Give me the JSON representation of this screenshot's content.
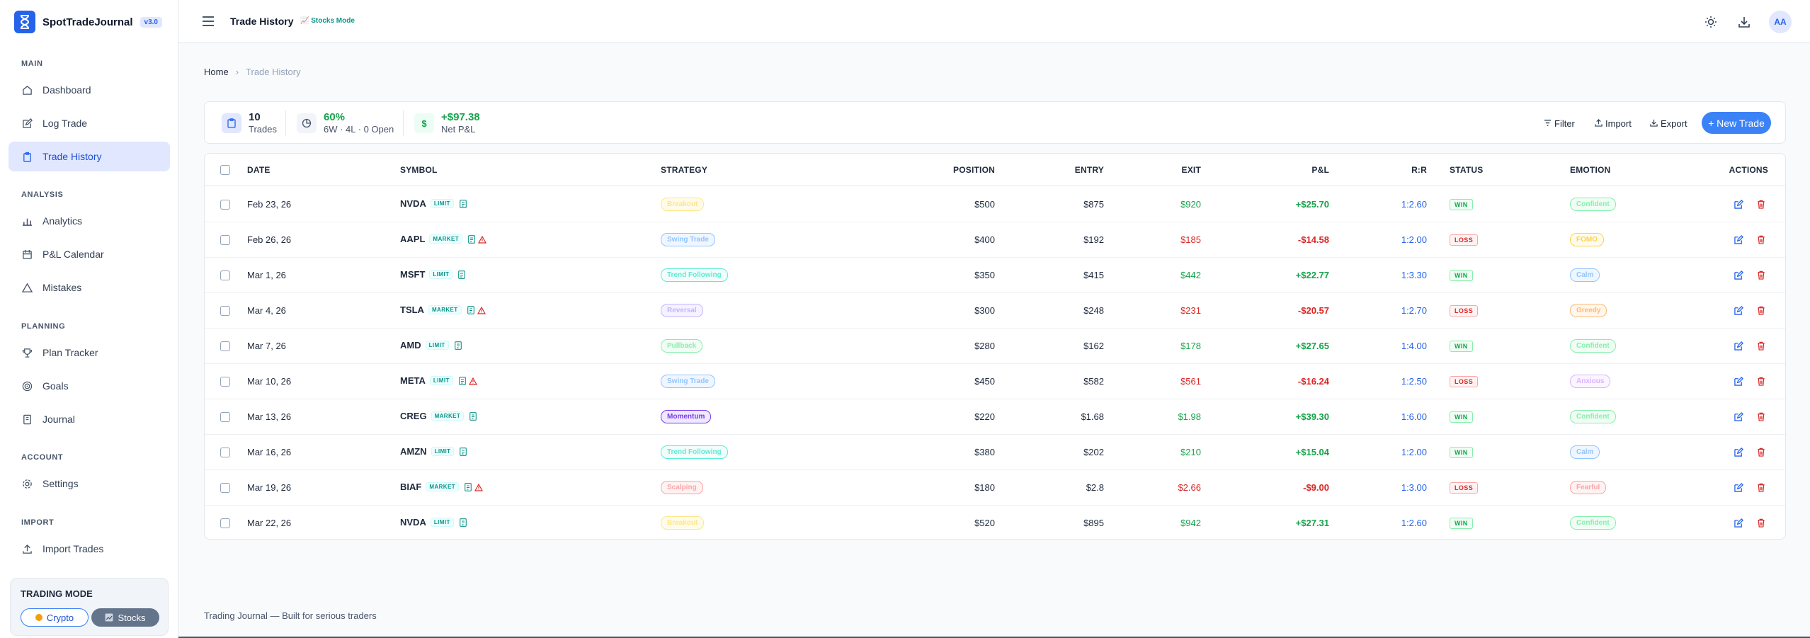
{
  "brand": {
    "name": "SpotTradeJournal",
    "version": "v3.0"
  },
  "nav": {
    "main": "MAIN",
    "dashboard": "Dashboard",
    "log_trade": "Log Trade",
    "trade_history": "Trade History",
    "analysis": "ANALYSIS",
    "analytics": "Analytics",
    "pnl_calendar": "P&L Calendar",
    "mistakes": "Mistakes",
    "planning": "PLANNING",
    "plan_tracker": "Plan Tracker",
    "goals": "Goals",
    "journal": "Journal",
    "account": "ACCOUNT",
    "settings": "Settings",
    "import": "IMPORT",
    "import_trades": "Import Trades"
  },
  "trading_mode": {
    "title": "TRADING MODE",
    "crypto": "Crypto",
    "stocks": "Stocks",
    "active": "Stocks"
  },
  "header": {
    "title": "Trade History",
    "mode_chip": "📈 Stocks Mode",
    "avatar": "AA"
  },
  "breadcrumb": {
    "home": "Home",
    "current": "Trade History"
  },
  "stats": {
    "trades_value": "10",
    "trades_label": "Trades",
    "winrate_value": "60%",
    "winrate_label": "6W · 4L · 0 Open",
    "pnl_value": "+$97.38",
    "pnl_label": "Net P&L"
  },
  "actions": {
    "filter": "Filter",
    "import": "Import",
    "export": "Export",
    "new_trade": "+ New Trade"
  },
  "table": {
    "headers": {
      "date": "DATE",
      "symbol": "SYMBOL",
      "strategy": "STRATEGY",
      "position": "POSITION",
      "entry": "ENTRY",
      "exit": "EXIT",
      "pnl": "P&L",
      "rr": "R:R",
      "status": "STATUS",
      "emotion": "EMOTION",
      "actions": "ACTIONS"
    },
    "rows": [
      {
        "date": "Feb 23, 26",
        "symbol": "NVDA",
        "order": "LIMIT",
        "warn": false,
        "strategy": "Breakout",
        "position": "$500",
        "entry": "$875",
        "exit": "$920",
        "pnl": "+$25.70",
        "rr": "1:2.60",
        "status": "WIN",
        "emotion": "Confident"
      },
      {
        "date": "Feb 26, 26",
        "symbol": "AAPL",
        "order": "MARKET",
        "warn": true,
        "strategy": "Swing Trade",
        "position": "$400",
        "entry": "$192",
        "exit": "$185",
        "pnl": "-$14.58",
        "rr": "1:2.00",
        "status": "LOSS",
        "emotion": "FOMO"
      },
      {
        "date": "Mar 1, 26",
        "symbol": "MSFT",
        "order": "LIMIT",
        "warn": false,
        "strategy": "Trend Following",
        "position": "$350",
        "entry": "$415",
        "exit": "$442",
        "pnl": "+$22.77",
        "rr": "1:3.30",
        "status": "WIN",
        "emotion": "Calm"
      },
      {
        "date": "Mar 4, 26",
        "symbol": "TSLA",
        "order": "MARKET",
        "warn": true,
        "strategy": "Reversal",
        "position": "$300",
        "entry": "$248",
        "exit": "$231",
        "pnl": "-$20.57",
        "rr": "1:2.70",
        "status": "LOSS",
        "emotion": "Greedy"
      },
      {
        "date": "Mar 7, 26",
        "symbol": "AMD",
        "order": "LIMIT",
        "warn": false,
        "strategy": "Pullback",
        "position": "$280",
        "entry": "$162",
        "exit": "$178",
        "pnl": "+$27.65",
        "rr": "1:4.00",
        "status": "WIN",
        "emotion": "Confident"
      },
      {
        "date": "Mar 10, 26",
        "symbol": "META",
        "order": "LIMIT",
        "warn": true,
        "strategy": "Swing Trade",
        "position": "$450",
        "entry": "$582",
        "exit": "$561",
        "pnl": "-$16.24",
        "rr": "1:2.50",
        "status": "LOSS",
        "emotion": "Anxious"
      },
      {
        "date": "Mar 13, 26",
        "symbol": "CREG",
        "order": "MARKET",
        "warn": false,
        "strategy": "Momentum",
        "position": "$220",
        "entry": "$1.68",
        "exit": "$1.98",
        "pnl": "+$39.30",
        "rr": "1:6.00",
        "status": "WIN",
        "emotion": "Confident"
      },
      {
        "date": "Mar 16, 26",
        "symbol": "AMZN",
        "order": "LIMIT",
        "warn": false,
        "strategy": "Trend Following",
        "position": "$380",
        "entry": "$202",
        "exit": "$210",
        "pnl": "+$15.04",
        "rr": "1:2.00",
        "status": "WIN",
        "emotion": "Calm"
      },
      {
        "date": "Mar 19, 26",
        "symbol": "BIAF",
        "order": "MARKET",
        "warn": true,
        "strategy": "Scalping",
        "position": "$180",
        "entry": "$2.8",
        "exit": "$2.66",
        "pnl": "-$9.00",
        "rr": "1:3.00",
        "status": "LOSS",
        "emotion": "Fearful"
      },
      {
        "date": "Mar 22, 26",
        "symbol": "NVDA",
        "order": "LIMIT",
        "warn": false,
        "strategy": "Breakout",
        "position": "$520",
        "entry": "$895",
        "exit": "$942",
        "pnl": "+$27.31",
        "rr": "1:2.60",
        "status": "WIN",
        "emotion": "Confident"
      }
    ]
  },
  "strategy_colors": {
    "Breakout": [
      "#fde68a",
      "#fffbeb"
    ],
    "Swing Trade": [
      "#93c5fd",
      "#eff6ff"
    ],
    "Trend Following": [
      "#5eead4",
      "#f0fdfa"
    ],
    "Reversal": [
      "#c4b5fd",
      "#f5f3ff"
    ],
    "Pullback": [
      "#86efac",
      "#f0fdf4"
    ],
    "Momentum": [
      "#7c3aed",
      "#ede9fe"
    ],
    "Scalping": [
      "#fca5a5",
      "#fef2f2"
    ]
  },
  "emotion_colors": {
    "Confident": [
      "#86efac",
      "#f0fdf4"
    ],
    "FOMO": [
      "#fcd34d",
      "#fffbeb"
    ],
    "Calm": [
      "#93c5fd",
      "#eff6ff"
    ],
    "Greedy": [
      "#fdba74",
      "#fff7ed"
    ],
    "Anxious": [
      "#d8b4fe",
      "#faf5ff"
    ],
    "Fearful": [
      "#fca5a5",
      "#fef2f2"
    ]
  },
  "footer": "Trading Journal — Built for serious traders"
}
